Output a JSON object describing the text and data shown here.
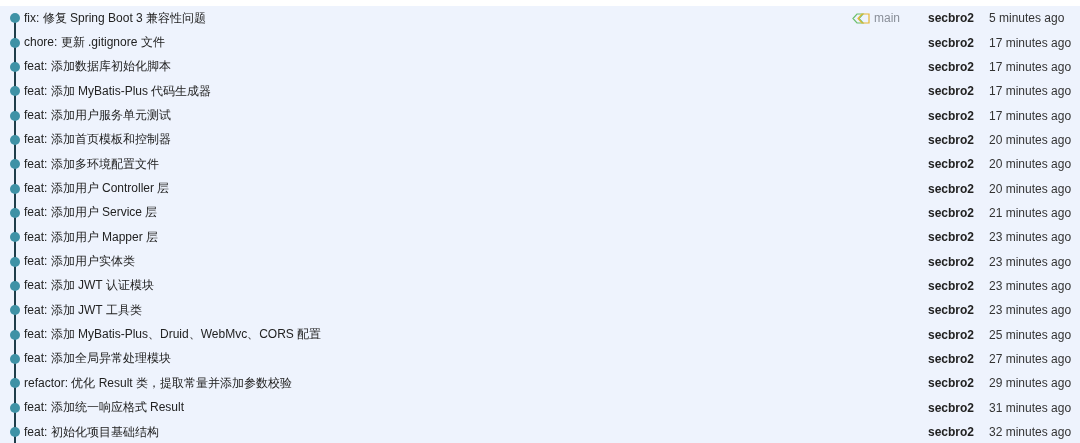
{
  "commits": [
    {
      "message": "fix: 修复 Spring Boot 3 兼容性问题",
      "branch": "main",
      "author": "secbro2",
      "time": "5 minutes ago"
    },
    {
      "message": "chore: 更新 .gitignore 文件",
      "author": "secbro2",
      "time": "17 minutes ago"
    },
    {
      "message": "feat: 添加数据库初始化脚本",
      "author": "secbro2",
      "time": "17 minutes ago"
    },
    {
      "message": "feat: 添加 MyBatis-Plus 代码生成器",
      "author": "secbro2",
      "time": "17 minutes ago"
    },
    {
      "message": "feat: 添加用户服务单元测试",
      "author": "secbro2",
      "time": "17 minutes ago"
    },
    {
      "message": "feat: 添加首页模板和控制器",
      "author": "secbro2",
      "time": "20 minutes ago"
    },
    {
      "message": "feat: 添加多环境配置文件",
      "author": "secbro2",
      "time": "20 minutes ago"
    },
    {
      "message": "feat: 添加用户 Controller 层",
      "author": "secbro2",
      "time": "20 minutes ago"
    },
    {
      "message": "feat: 添加用户 Service 层",
      "author": "secbro2",
      "time": "21 minutes ago"
    },
    {
      "message": "feat: 添加用户 Mapper 层",
      "author": "secbro2",
      "time": "23 minutes ago"
    },
    {
      "message": "feat: 添加用户实体类",
      "author": "secbro2",
      "time": "23 minutes ago"
    },
    {
      "message": "feat: 添加 JWT 认证模块",
      "author": "secbro2",
      "time": "23 minutes ago"
    },
    {
      "message": "feat: 添加 JWT 工具类",
      "author": "secbro2",
      "time": "23 minutes ago"
    },
    {
      "message": "feat: 添加 MyBatis-Plus、Druid、WebMvc、CORS 配置",
      "author": "secbro2",
      "time": "25 minutes ago"
    },
    {
      "message": "feat: 添加全局异常处理模块",
      "author": "secbro2",
      "time": "27 minutes ago"
    },
    {
      "message": "refactor: 优化 Result 类，提取常量并添加参数校验",
      "author": "secbro2",
      "time": "29 minutes ago"
    },
    {
      "message": "feat: 添加统一响应格式 Result",
      "author": "secbro2",
      "time": "31 minutes ago"
    },
    {
      "message": "feat: 初始化项目基础结构",
      "author": "secbro2",
      "time": "32 minutes ago"
    }
  ]
}
